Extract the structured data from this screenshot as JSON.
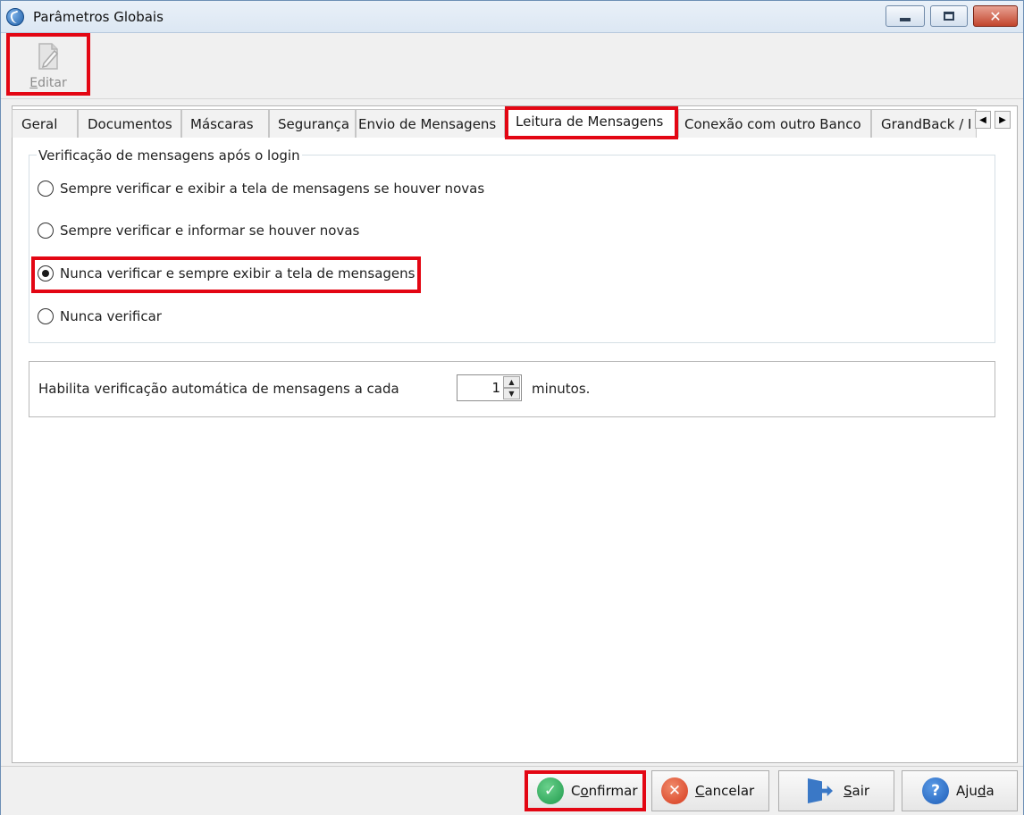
{
  "window": {
    "title": "Parâmetros Globais"
  },
  "toolbar": {
    "edit_label": "Editar",
    "edit_mnemonic": "E",
    "edit_rest": "ditar"
  },
  "tabs": [
    {
      "label": "Geral"
    },
    {
      "label": "Documentos"
    },
    {
      "label": "Máscaras"
    },
    {
      "label": "Segurança"
    },
    {
      "label": "Envio de Mensagens"
    },
    {
      "label": "Leitura de Mensagens",
      "active": true
    },
    {
      "label": "Conexão com outro Banco"
    },
    {
      "label": "GrandBack / I"
    }
  ],
  "login_check": {
    "legend": "Verificação de mensagens após o login",
    "options": [
      {
        "label": "Sempre verificar e exibir a tela de mensagens se houver novas",
        "selected": false
      },
      {
        "label": "Sempre verificar e informar se houver novas",
        "selected": false
      },
      {
        "label": "Nunca verificar e sempre exibir a tela de mensagens",
        "selected": true
      },
      {
        "label": "Nunca verificar",
        "selected": false
      }
    ]
  },
  "auto_check": {
    "label": "Habilita verificação automática de mensagens a cada",
    "value": "1",
    "unit": "minutos."
  },
  "buttons": {
    "confirm": {
      "mnemonic": "o",
      "pre": "C",
      "post": "nfirmar"
    },
    "cancel": {
      "mnemonic": "C",
      "pre": "",
      "post": "ancelar"
    },
    "exit": {
      "mnemonic": "S",
      "pre": "",
      "post": "air"
    },
    "help": {
      "mnemonic": "d",
      "pre": "Aju",
      "post": "a"
    }
  },
  "colors": {
    "highlight": "#e30613",
    "title_bar": "#dce7f3",
    "close_button": "#c2452d"
  }
}
